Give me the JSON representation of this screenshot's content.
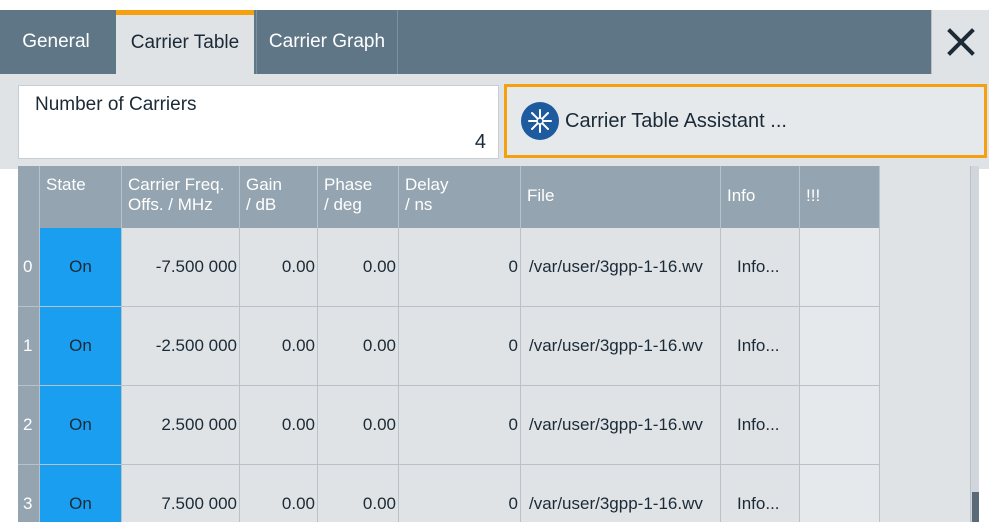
{
  "tabs": [
    {
      "label": "General"
    },
    {
      "label": "Carrier Table"
    },
    {
      "label": "Carrier Graph"
    }
  ],
  "close_icon": "close-icon",
  "number_of_carriers": {
    "label": "Number of Carriers",
    "value": "4"
  },
  "assistant_button": {
    "label": "Carrier Table Assistant ...",
    "icon": "wizard-star-icon"
  },
  "table": {
    "columns": [
      "State",
      "Carrier Freq.\nOffs. / MHz",
      "Gain\n/ dB",
      "Phase\n/ deg",
      "Delay\n/ ns",
      "File",
      "Info",
      "!!!"
    ],
    "rows": [
      {
        "index": "0",
        "state": "On",
        "freq": "-7.500 000",
        "gain": "0.00",
        "phase": "0.00",
        "delay": "0",
        "file": "/var/user/3gpp-1-16.wv",
        "info": "Info..."
      },
      {
        "index": "1",
        "state": "On",
        "freq": "-2.500 000",
        "gain": "0.00",
        "phase": "0.00",
        "delay": "0",
        "file": "/var/user/3gpp-1-16.wv",
        "info": "Info..."
      },
      {
        "index": "2",
        "state": "On",
        "freq": "2.500 000",
        "gain": "0.00",
        "phase": "0.00",
        "delay": "0",
        "file": "/var/user/3gpp-1-16.wv",
        "info": "Info..."
      },
      {
        "index": "3",
        "state": "On",
        "freq": "7.500 000",
        "gain": "0.00",
        "phase": "0.00",
        "delay": "0",
        "file": "/var/user/3gpp-1-16.wv",
        "info": "Info..."
      }
    ]
  },
  "colors": {
    "tab_bar": "#5f7686",
    "active_tab": "#dfe3e6",
    "accent_orange": "#f5a10f",
    "state_on_blue": "#1a9ff0",
    "header_gray": "#94a4b0"
  }
}
